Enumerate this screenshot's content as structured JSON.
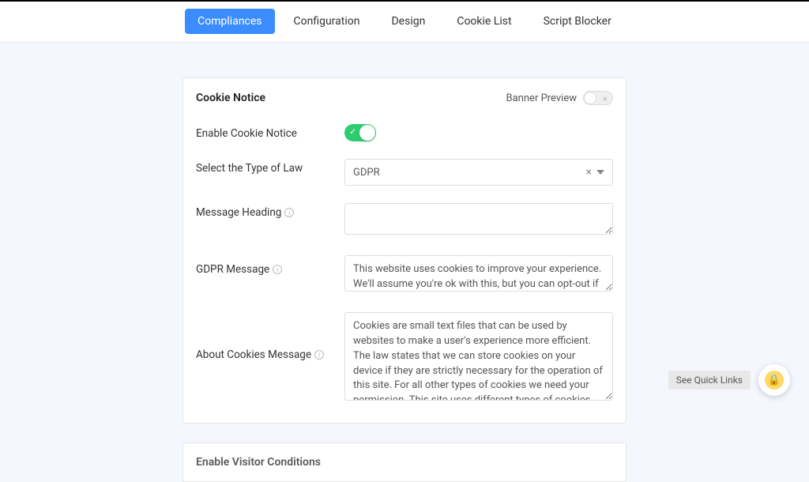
{
  "tabs": {
    "compliances": "Compliances",
    "configuration": "Configuration",
    "design": "Design",
    "cookie_list": "Cookie List",
    "script_blocker": "Script Blocker"
  },
  "card": {
    "title": "Cookie Notice",
    "banner_preview_label": "Banner Preview",
    "labels": {
      "enable": "Enable Cookie Notice",
      "law_type": "Select the Type of Law",
      "message_heading": "Message Heading",
      "gdpr_message": "GDPR Message",
      "about_cookies": "About Cookies Message"
    },
    "values": {
      "law_type": "GDPR",
      "message_heading": "",
      "gdpr_message": "This website uses cookies to improve your experience. We'll assume you're ok with this, but you can opt-out if you wish.",
      "about_cookies": "Cookies are small text files that can be used by websites to make a user's experience more efficient. The law states that we can store cookies on your device if they are strictly necessary for the operation of this site. For all other types of cookies we need your permission. This site uses different types of cookies. Some cookies are placed by third party services that appear on our pages."
    }
  },
  "partial_card": {
    "title": "Enable Visitor Conditions"
  },
  "quick_links": "See Quick Links"
}
